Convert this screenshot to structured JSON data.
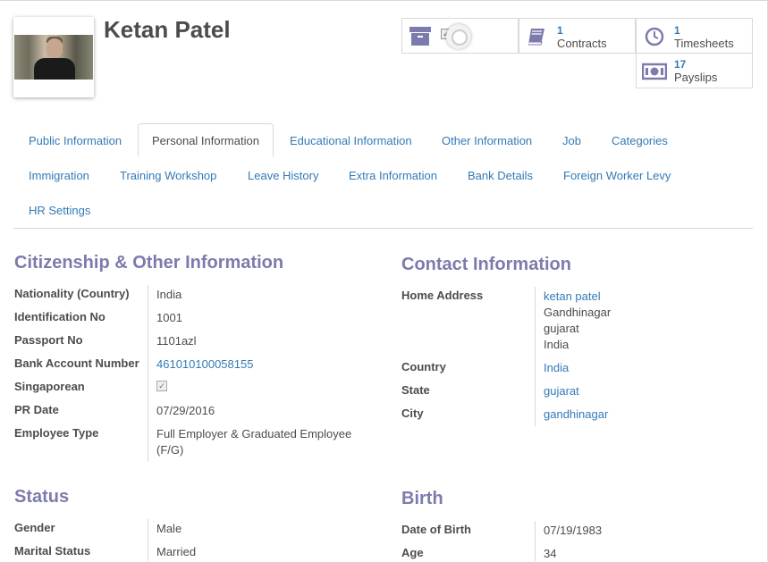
{
  "employee": {
    "name": "Ketan Patel"
  },
  "stats": {
    "contracts": {
      "count": "1",
      "label": "Contracts"
    },
    "timesheets": {
      "count": "1",
      "label": "Timesheets"
    },
    "payslips": {
      "count": "17",
      "label": "Payslips"
    }
  },
  "tabs": [
    {
      "label": "Public Information",
      "active": false
    },
    {
      "label": "Personal Information",
      "active": true
    },
    {
      "label": "Educational Information",
      "active": false
    },
    {
      "label": "Other Information",
      "active": false
    },
    {
      "label": "Job",
      "active": false
    },
    {
      "label": "Categories",
      "active": false
    },
    {
      "label": "Immigration",
      "active": false
    },
    {
      "label": "Training Workshop",
      "active": false
    },
    {
      "label": "Leave History",
      "active": false
    },
    {
      "label": "Extra Information",
      "active": false
    },
    {
      "label": "Bank Details",
      "active": false
    },
    {
      "label": "Foreign Worker Levy",
      "active": false
    },
    {
      "label": "HR Settings",
      "active": false
    }
  ],
  "citizenship": {
    "title": "Citizenship & Other Information",
    "nationality": {
      "label": "Nationality (Country)",
      "value": "India"
    },
    "identification": {
      "label": "Identification No",
      "value": "1001"
    },
    "passport": {
      "label": "Passport No",
      "value": "1101azl"
    },
    "bank_account": {
      "label": "Bank Account Number",
      "value": "461010100058155"
    },
    "singaporean": {
      "label": "Singaporean",
      "checked": true
    },
    "pr_date": {
      "label": "PR Date",
      "value": "07/29/2016"
    },
    "employee_type": {
      "label": "Employee Type",
      "value_line1": "Full Employer & Graduated Employee",
      "value_line2": "(F/G)"
    }
  },
  "contact": {
    "title": "Contact Information",
    "home_address": {
      "label": "Home Address",
      "name": "ketan patel",
      "line1": "Gandhinagar",
      "line2": "gujarat",
      "line3": "India"
    },
    "country": {
      "label": "Country",
      "value": "India"
    },
    "state": {
      "label": "State",
      "value": "gujarat"
    },
    "city": {
      "label": "City",
      "value": "gandhinagar"
    }
  },
  "status": {
    "title": "Status",
    "gender": {
      "label": "Gender",
      "value": "Male"
    },
    "marital": {
      "label": "Marital Status",
      "value": "Married"
    }
  },
  "birth": {
    "title": "Birth",
    "dob": {
      "label": "Date of Birth",
      "value": "07/19/1983"
    },
    "age": {
      "label": "Age",
      "value": "34"
    }
  },
  "colors": {
    "accent": "#7c7bad",
    "link": "#337ab7",
    "text": "#4c4c4c",
    "border": "#d9d9d9"
  }
}
